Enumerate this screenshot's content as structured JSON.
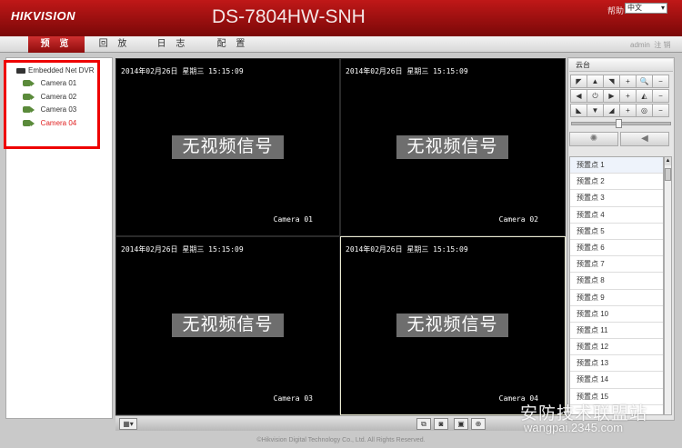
{
  "header": {
    "brand": "HIKVISION",
    "model": "DS-7804HW-SNH",
    "help": "帮助",
    "language": "中文"
  },
  "nav": {
    "tabs": [
      {
        "label": "预 览"
      },
      {
        "label": "回 放"
      },
      {
        "label": "日 志"
      },
      {
        "label": "配 置"
      }
    ],
    "user": "admin",
    "user_actions": "注 销"
  },
  "tree": {
    "root": "Embedded Net DVR",
    "cameras": [
      "Camera 01",
      "Camera 02",
      "Camera 03",
      "Camera 04"
    ]
  },
  "video": {
    "osd_time": "2014年02月26日 星期三 15:15:09",
    "no_signal": "无视频信号",
    "channels": [
      "Camera 01",
      "Camera 02",
      "Camera 03",
      "Camera 04"
    ]
  },
  "ptz": {
    "title": "云台",
    "presets": [
      "预置点 1",
      "预置点 2",
      "预置点 3",
      "预置点 4",
      "预置点 5",
      "预置点 6",
      "预置点 7",
      "预置点 8",
      "预置点 9",
      "预置点 10",
      "预置点 11",
      "预置点 12",
      "预置点 13",
      "预置点 14",
      "预置点 15"
    ]
  },
  "footer": {
    "copyright": "©Hikvision Digital Technology Co., Ltd. All Rights Reserved."
  },
  "watermark": {
    "text": "安防技术联盟站",
    "url": "wangpai.2345.com"
  }
}
